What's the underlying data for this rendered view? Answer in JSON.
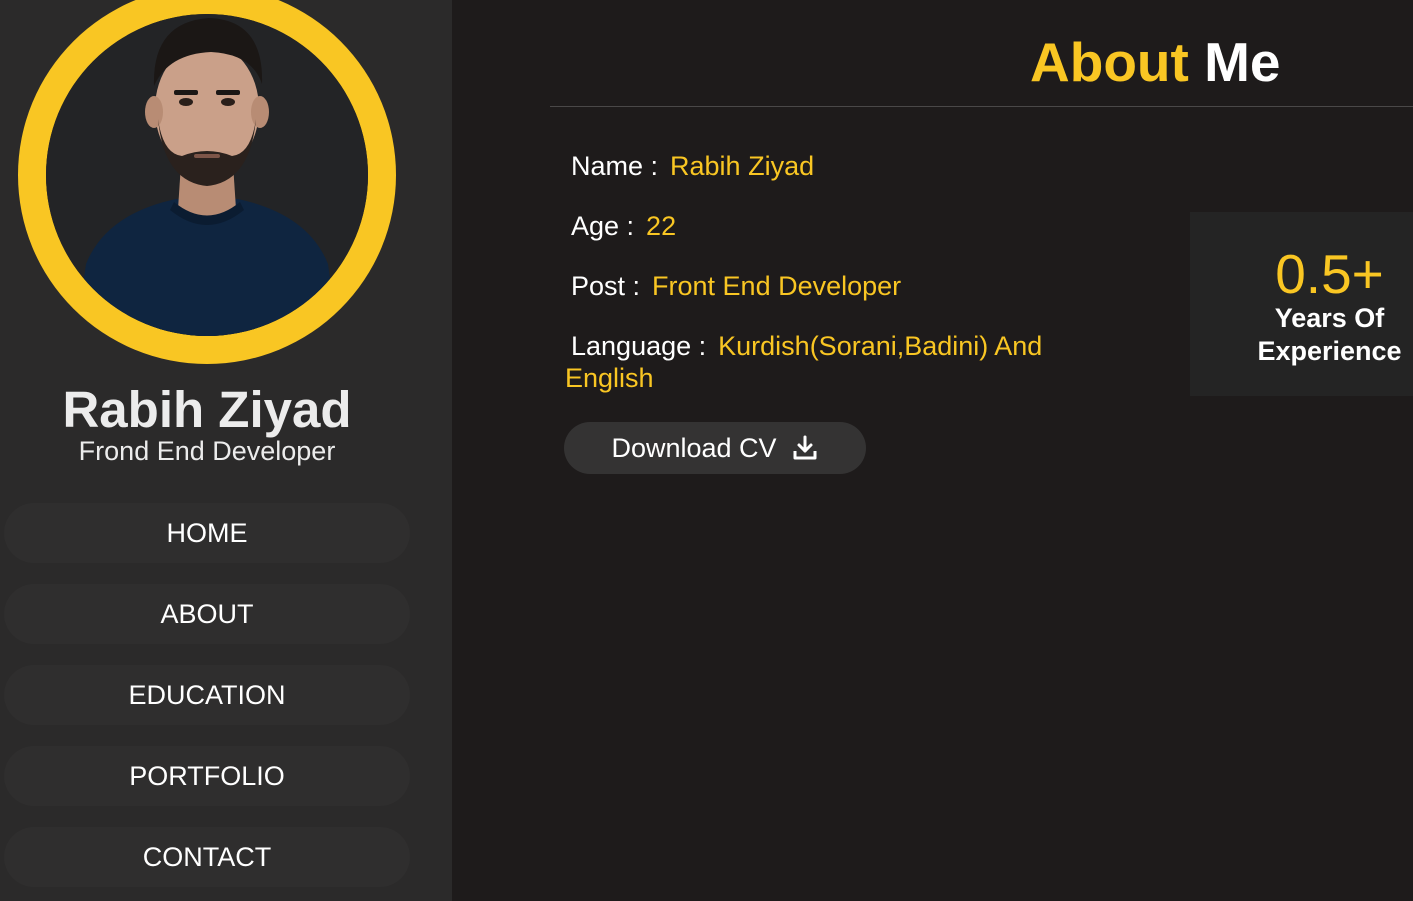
{
  "profile": {
    "name": "Rabih Ziyad",
    "role": "Frond End Developer"
  },
  "nav": {
    "items": [
      {
        "label": "HOME"
      },
      {
        "label": "ABOUT"
      },
      {
        "label": "EDUCATION"
      },
      {
        "label": "PORTFOLIO"
      },
      {
        "label": "CONTACT"
      }
    ]
  },
  "about": {
    "title_first": "About",
    "title_second": "Me",
    "info": [
      {
        "label": "Name :",
        "value": "Rabih Ziyad"
      },
      {
        "label": "Age :",
        "value": "22"
      },
      {
        "label": "Post :",
        "value": "Front End Developer"
      },
      {
        "label": "Language :",
        "value": "Kurdish(Sorani,Badini) And English"
      }
    ],
    "download_label": "Download CV",
    "download_icon": "download-icon"
  },
  "experience": {
    "value": "0.5+",
    "label_line1": "Years Of",
    "label_line2": "Experience"
  },
  "colors": {
    "accent": "#f9c623",
    "sidebar_bg": "#2b2a2a",
    "main_bg": "#1e1b1b"
  }
}
